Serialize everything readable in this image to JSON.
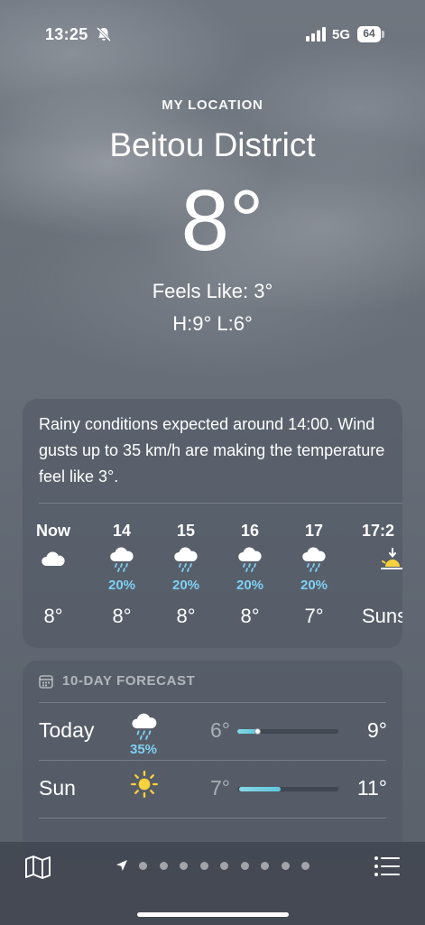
{
  "status_bar": {
    "time": "13:25",
    "network": "5G",
    "battery": "64"
  },
  "header": {
    "location_label": "MY LOCATION",
    "city": "Beitou District",
    "temperature": "8°",
    "feels_like": "Feels Like: 3°",
    "high_low": "H:9°  L:6°"
  },
  "hourly": {
    "summary": "Rainy conditions expected around 14:00. Wind gusts up to 35 km/h are making the temperature feel like 3°.",
    "items": [
      {
        "label": "Now",
        "icon": "cloud-icon",
        "precip": "",
        "temp": "8°"
      },
      {
        "label": "14",
        "icon": "rain-icon",
        "precip": "20%",
        "temp": "8°"
      },
      {
        "label": "15",
        "icon": "rain-icon",
        "precip": "20%",
        "temp": "8°"
      },
      {
        "label": "16",
        "icon": "rain-icon",
        "precip": "20%",
        "temp": "8°"
      },
      {
        "label": "17",
        "icon": "rain-icon",
        "precip": "20%",
        "temp": "7°"
      },
      {
        "label": "17:2",
        "icon": "sunset-icon",
        "precip": "",
        "temp": "Suns"
      }
    ]
  },
  "forecast": {
    "title": "10-DAY FORECAST",
    "rows": [
      {
        "day": "Today",
        "icon": "rain-icon",
        "precip": "35%",
        "low": "6°",
        "high": "9°",
        "range_start": 0.0,
        "range_end": 0.2,
        "current": 0.2
      },
      {
        "day": "Sun",
        "icon": "sun-icon",
        "precip": "",
        "low": "7°",
        "high": "11°",
        "range_start": 0.02,
        "range_end": 0.43,
        "current": null
      }
    ]
  },
  "toolbar": {
    "map_icon": "map-icon",
    "location_icon": "location-arrow-icon",
    "page_count": 9,
    "list_icon": "list-icon"
  },
  "colors": {
    "precip": "#7fd0f2",
    "sun": "#f7d23a",
    "range_bar": "#5fc7dc"
  }
}
